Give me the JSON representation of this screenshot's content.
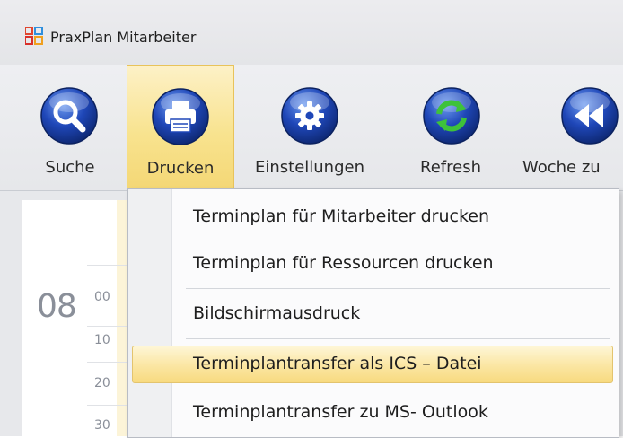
{
  "window": {
    "title": "PraxPlan Mitarbeiter",
    "logo_icon": "app-grid-logo-icon"
  },
  "ribbon": {
    "buttons": [
      {
        "label": "Suche",
        "icon": "search-icon",
        "color": "#1d3f9a"
      },
      {
        "label": "Drucken",
        "icon": "printer-icon",
        "color": "#1d3f9a",
        "active": true
      },
      {
        "label": "Einstellungen",
        "icon": "gear-icon",
        "color": "#1d3f9a"
      },
      {
        "label": "Refresh",
        "icon": "refresh-icon",
        "color": "#1d3f9a"
      },
      {
        "label": "Woche zu",
        "icon": "rewind-icon",
        "color": "#1d3f9a"
      }
    ]
  },
  "calendar": {
    "hour": "08",
    "hour_minutes": "00",
    "minutes": [
      "10",
      "20",
      "30"
    ]
  },
  "print_menu": {
    "items": [
      {
        "label": "Terminplan für Mitarbeiter drucken"
      },
      {
        "label": "Terminplan für Ressourcen drucken"
      },
      {
        "label": "Bildschirmausdruck"
      },
      {
        "label": "Terminplantransfer als ICS – Datei",
        "highlighted": true
      },
      {
        "label": "Terminplantransfer zu MS- Outlook"
      }
    ]
  },
  "colors": {
    "highlight": "#f8da7f",
    "active_button": "#f8e38f",
    "icon_blue": "#1d3f9a"
  }
}
